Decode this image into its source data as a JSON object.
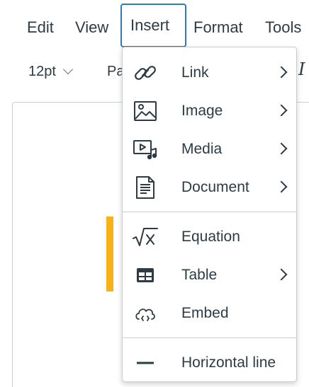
{
  "menubar": {
    "items": [
      {
        "label": "Edit"
      },
      {
        "label": "View"
      },
      {
        "label": "Insert"
      },
      {
        "label": "Format"
      },
      {
        "label": "Tools"
      }
    ],
    "active_item": "Insert",
    "active_border_color": "#2b7abc"
  },
  "toolbar": {
    "font_size": "12pt",
    "paragraph_partial": "Pa",
    "italic_icon": "italic-icon"
  },
  "insert_menu": {
    "items": [
      {
        "label": "Link",
        "icon": "link-icon",
        "has_submenu": true
      },
      {
        "label": "Image",
        "icon": "image-icon",
        "has_submenu": true
      },
      {
        "label": "Media",
        "icon": "media-icon",
        "has_submenu": true
      },
      {
        "label": "Document",
        "icon": "document-icon",
        "has_submenu": true
      },
      {
        "label": "Equation",
        "icon": "equation-icon",
        "has_submenu": false
      },
      {
        "label": "Table",
        "icon": "table-icon",
        "has_submenu": true
      },
      {
        "label": "Embed",
        "icon": "embed-icon",
        "has_submenu": false
      },
      {
        "label": "Horizontal line",
        "icon": "horizontal-line-icon",
        "has_submenu": false
      }
    ]
  },
  "colors": {
    "text": "#2d3b45",
    "accent_bar": "#f8b217",
    "border": "#c7cdd1"
  }
}
